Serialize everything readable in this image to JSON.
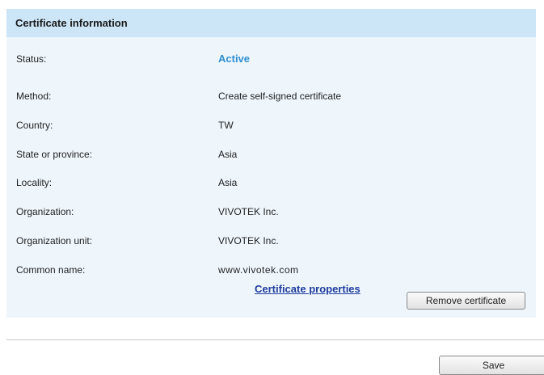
{
  "section": {
    "title": "Certificate information"
  },
  "fields": [
    {
      "label": "Status:",
      "value": "Active"
    },
    {
      "label": "Method:",
      "value": "Create self-signed certificate"
    },
    {
      "label": "Country:",
      "value": "TW"
    },
    {
      "label": "State or province:",
      "value": "Asia"
    },
    {
      "label": "Locality:",
      "value": "Asia"
    },
    {
      "label": "Organization:",
      "value": "VIVOTEK Inc."
    },
    {
      "label": "Organization unit:",
      "value": "VIVOTEK Inc."
    },
    {
      "label": "Common name:",
      "value": "www.vivotek.com"
    }
  ],
  "actions": {
    "properties_link": "Certificate properties",
    "remove_button": "Remove certificate",
    "save_button": "Save"
  },
  "colors": {
    "header_bg": "#cde6f7",
    "panel_bg": "#eef6fc",
    "status_active": "#2f8fd0",
    "link": "#1f3b9e"
  }
}
